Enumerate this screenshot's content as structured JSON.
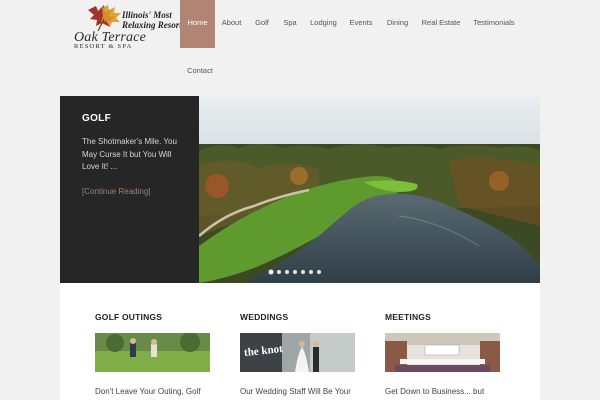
{
  "header": {
    "logo": {
      "tagline": "Illinois' Most Relaxing Resort",
      "name": "Oak Terrace",
      "subname": "RESORT & SPA"
    },
    "nav": [
      {
        "label": "Home",
        "active": true
      },
      {
        "label": "About"
      },
      {
        "label": "Golf"
      },
      {
        "label": "Spa"
      },
      {
        "label": "Lodging"
      },
      {
        "label": "Events"
      },
      {
        "label": "Dining"
      },
      {
        "label": "Real Estate"
      },
      {
        "label": "Testimonials"
      },
      {
        "label": "Contact"
      }
    ]
  },
  "hero": {
    "title": "GOLF",
    "description": "The Shotmaker's Mile. You May Curse It but You Will Love It! ...",
    "link": "[Continue Reading]",
    "slides_total": 7,
    "active_slide": 1
  },
  "features": [
    {
      "title": "GOLF OUTINGS",
      "excerpt": "Don't Leave Your Outing, Golf",
      "image_icon": "golfers-photo"
    },
    {
      "title": "WEDDINGS",
      "excerpt": "Our Wedding Staff Will Be Your",
      "image_icon": "wedding-photo",
      "image_text": "the knot"
    },
    {
      "title": "MEETINGS",
      "excerpt": "Get Down to Business... but",
      "image_icon": "meeting-room-photo"
    }
  ],
  "colors": {
    "accent": "#b08573",
    "link": "#a0806f",
    "hero_panel": "#262626",
    "page_bg": "#f1f1f1"
  }
}
